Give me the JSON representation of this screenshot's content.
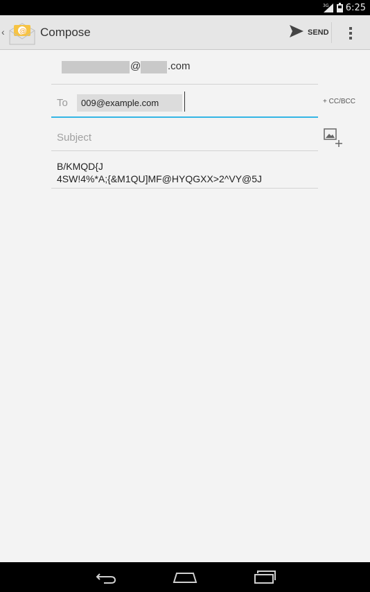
{
  "status_bar": {
    "network": "3G",
    "time": "6:25"
  },
  "action_bar": {
    "title": "Compose",
    "send_label": "SEND"
  },
  "compose": {
    "from_at": "@",
    "from_domain_suffix": ".com",
    "to_label": "To",
    "to_recipient": "009@example.com",
    "cc_bcc_label": "+ CC/BCC",
    "subject_placeholder": "Subject",
    "body_line1": "B/KMQD{J",
    "body_line2": "4SW!4%*A;{&M1QU]MF@HYQGXX>2^VY@5J"
  },
  "colors": {
    "accent": "#33b5e5",
    "action_bar_bg": "#e6e6e6",
    "content_bg": "#f3f3f3"
  },
  "icons": {
    "up": "chevron-left-icon",
    "app": "email-app-icon",
    "send": "send-arrow-icon",
    "overflow": "overflow-menu-icon",
    "attach": "add-picture-icon",
    "nav_back": "back-icon",
    "nav_home": "home-icon",
    "nav_recents": "recents-icon"
  }
}
